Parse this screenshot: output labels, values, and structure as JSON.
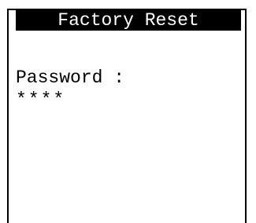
{
  "screen": {
    "title": "Factory Reset",
    "password_label": "Password :",
    "password_value": "****"
  },
  "colors": {
    "background": "#ffffff",
    "foreground": "#000000",
    "title_bar": "#000000",
    "title_text": "#ffffff"
  }
}
